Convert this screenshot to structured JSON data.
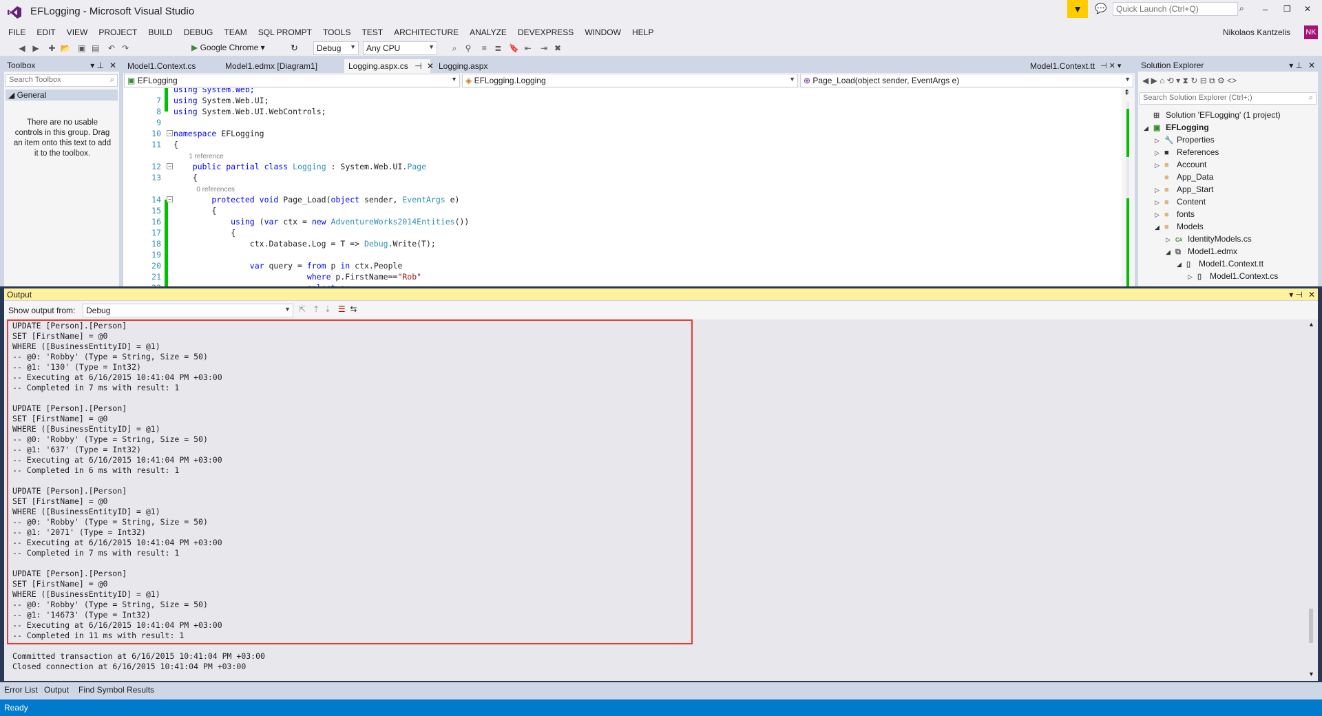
{
  "window": {
    "title": "EFLogging - Microsoft Visual Studio",
    "quick_launch_placeholder": "Quick Launch (Ctrl+Q)",
    "user": "Nikolaos Kantzelis",
    "user_initials": "NK",
    "min": "–",
    "max": "❐",
    "close": "✕"
  },
  "menu": [
    "FILE",
    "EDIT",
    "VIEW",
    "PROJECT",
    "BUILD",
    "DEBUG",
    "TEAM",
    "SQL PROMPT",
    "TOOLS",
    "TEST",
    "ARCHITECTURE",
    "ANALYZE",
    "DEVEXPRESS",
    "WINDOW",
    "HELP"
  ],
  "toolbar": {
    "run_target": "Google Chrome",
    "config": "Debug",
    "platform": "Any CPU"
  },
  "toolbox": {
    "title": "Toolbox",
    "search_placeholder": "Search Toolbox",
    "group": "General",
    "empty_text": "There are no usable controls in this group. Drag an item onto this text to add it to the toolbox."
  },
  "doc_tabs": [
    {
      "label": "Model1.Context.cs"
    },
    {
      "label": "Model1.edmx [Diagram1]"
    },
    {
      "label": "Logging.aspx.cs"
    },
    {
      "label": "Logging.aspx"
    }
  ],
  "doc_tab_right": "Model1.Context.tt",
  "nav": {
    "project": "EFLogging",
    "type": "EFLogging.Logging",
    "member": "Page_Load(object sender, EventArgs e)"
  },
  "code": [
    {
      "n": "",
      "parts": [
        {
          "t": "using System.Web;",
          "c": "kw0"
        }
      ]
    },
    {
      "n": "7",
      "parts": [
        {
          "t": "using",
          "c": "kw"
        },
        {
          "t": " System.Web.UI;"
        }
      ]
    },
    {
      "n": "8",
      "parts": [
        {
          "t": "using",
          "c": "kw"
        },
        {
          "t": " System.Web.UI.WebControls;"
        }
      ]
    },
    {
      "n": "9",
      "parts": []
    },
    {
      "n": "10",
      "parts": [
        {
          "t": "namespace",
          "c": "kw"
        },
        {
          "t": " EFLogging"
        }
      ]
    },
    {
      "n": "11",
      "parts": [
        {
          "t": "{"
        }
      ]
    },
    {
      "n": "",
      "parts": [
        {
          "t": "        1 reference",
          "c": "cl"
        }
      ]
    },
    {
      "n": "12",
      "parts": [
        {
          "t": "    "
        },
        {
          "t": "public",
          "c": "kw"
        },
        {
          "t": " "
        },
        {
          "t": "partial",
          "c": "kw"
        },
        {
          "t": " "
        },
        {
          "t": "class",
          "c": "kw"
        },
        {
          "t": " "
        },
        {
          "t": "Logging",
          "c": "ty"
        },
        {
          "t": " : System.Web.UI."
        },
        {
          "t": "Page",
          "c": "ty"
        }
      ]
    },
    {
      "n": "13",
      "parts": [
        {
          "t": "    {"
        }
      ]
    },
    {
      "n": "",
      "parts": [
        {
          "t": "            0 references",
          "c": "cl"
        }
      ]
    },
    {
      "n": "14",
      "parts": [
        {
          "t": "        "
        },
        {
          "t": "protected",
          "c": "kw"
        },
        {
          "t": " "
        },
        {
          "t": "void",
          "c": "kw"
        },
        {
          "t": " Page_Load("
        },
        {
          "t": "object",
          "c": "kw"
        },
        {
          "t": " sender, "
        },
        {
          "t": "EventArgs",
          "c": "ty"
        },
        {
          "t": " e)"
        }
      ]
    },
    {
      "n": "15",
      "parts": [
        {
          "t": "        {"
        }
      ]
    },
    {
      "n": "16",
      "parts": [
        {
          "t": "            "
        },
        {
          "t": "using",
          "c": "kw"
        },
        {
          "t": " ("
        },
        {
          "t": "var",
          "c": "kw"
        },
        {
          "t": " ctx = "
        },
        {
          "t": "new",
          "c": "kw"
        },
        {
          "t": " "
        },
        {
          "t": "AdventureWorks2014Entities",
          "c": "ty"
        },
        {
          "t": "())"
        }
      ]
    },
    {
      "n": "17",
      "parts": [
        {
          "t": "            {"
        }
      ]
    },
    {
      "n": "18",
      "parts": [
        {
          "t": "                ctx.Database.Log = T => "
        },
        {
          "t": "Debug",
          "c": "ty"
        },
        {
          "t": ".Write(T);"
        }
      ]
    },
    {
      "n": "19",
      "parts": []
    },
    {
      "n": "20",
      "parts": [
        {
          "t": "                "
        },
        {
          "t": "var",
          "c": "kw"
        },
        {
          "t": " query = "
        },
        {
          "t": "from",
          "c": "kw"
        },
        {
          "t": " p "
        },
        {
          "t": "in",
          "c": "kw"
        },
        {
          "t": " ctx.People"
        }
      ]
    },
    {
      "n": "21",
      "parts": [
        {
          "t": "                            "
        },
        {
          "t": "where",
          "c": "kw"
        },
        {
          "t": " p.FirstName=="
        },
        {
          "t": "\"Rob\"",
          "c": "st"
        }
      ]
    },
    {
      "n": "22",
      "parts": [
        {
          "t": "                            "
        },
        {
          "t": "select",
          "c": "kw"
        },
        {
          "t": " p;"
        }
      ]
    }
  ],
  "solution": {
    "title": "Solution Explorer",
    "search_placeholder": "Search Solution Explorer (Ctrl+;)",
    "items": [
      {
        "label": "Solution 'EFLogging' (1 project)",
        "level": 0,
        "exp": "",
        "icon": "solution-icon",
        "bold": false
      },
      {
        "label": "EFLogging",
        "level": 0,
        "exp": "◢",
        "icon": "project-icon",
        "bold": true
      },
      {
        "label": "Properties",
        "level": 1,
        "exp": "▷",
        "icon": "wrench-icon",
        "bold": false
      },
      {
        "label": "References",
        "level": 1,
        "exp": "▷",
        "icon": "references-icon",
        "bold": false
      },
      {
        "label": "Account",
        "level": 1,
        "exp": "▷",
        "icon": "folder-icon",
        "bold": false
      },
      {
        "label": "App_Data",
        "level": 1,
        "exp": "",
        "icon": "folder-icon",
        "bold": false
      },
      {
        "label": "App_Start",
        "level": 1,
        "exp": "▷",
        "icon": "folder-icon",
        "bold": false
      },
      {
        "label": "Content",
        "level": 1,
        "exp": "▷",
        "icon": "folder-icon",
        "bold": false
      },
      {
        "label": "fonts",
        "level": 1,
        "exp": "▷",
        "icon": "folder-icon",
        "bold": false
      },
      {
        "label": "Models",
        "level": 1,
        "exp": "◢",
        "icon": "folder-icon",
        "bold": false
      },
      {
        "label": "IdentityModels.cs",
        "level": 2,
        "exp": "▷",
        "icon": "csharp-icon",
        "bold": false
      },
      {
        "label": "Model1.edmx",
        "level": 2,
        "exp": "◢",
        "icon": "edmx-icon",
        "bold": false
      },
      {
        "label": "Model1.Context.tt",
        "level": 3,
        "exp": "◢",
        "icon": "tt-file-icon",
        "bold": false
      },
      {
        "label": "Model1.Context.cs",
        "level": 4,
        "exp": "▷",
        "icon": "tt-file-icon",
        "bold": false
      }
    ]
  },
  "output": {
    "title": "Output",
    "show_from_label": "Show output from:",
    "source": "Debug",
    "lines": [
      "UPDATE [Person].[Person]",
      "SET [FirstName] = @0",
      "WHERE ([BusinessEntityID] = @1)",
      "-- @0: 'Robby' (Type = String, Size = 50)",
      "-- @1: '130' (Type = Int32)",
      "-- Executing at 6/16/2015 10:41:04 PM +03:00",
      "-- Completed in 7 ms with result: 1",
      "",
      "UPDATE [Person].[Person]",
      "SET [FirstName] = @0",
      "WHERE ([BusinessEntityID] = @1)",
      "-- @0: 'Robby' (Type = String, Size = 50)",
      "-- @1: '637' (Type = Int32)",
      "-- Executing at 6/16/2015 10:41:04 PM +03:00",
      "-- Completed in 6 ms with result: 1",
      "",
      "UPDATE [Person].[Person]",
      "SET [FirstName] = @0",
      "WHERE ([BusinessEntityID] = @1)",
      "-- @0: 'Robby' (Type = String, Size = 50)",
      "-- @1: '2071' (Type = Int32)",
      "-- Executing at 6/16/2015 10:41:04 PM +03:00",
      "-- Completed in 7 ms with result: 1",
      "",
      "UPDATE [Person].[Person]",
      "SET [FirstName] = @0",
      "WHERE ([BusinessEntityID] = @1)",
      "-- @0: 'Robby' (Type = String, Size = 50)",
      "-- @1: '14673' (Type = Int32)",
      "-- Executing at 6/16/2015 10:41:04 PM +03:00",
      "-- Completed in 11 ms with result: 1",
      "",
      "Committed transaction at 6/16/2015 10:41:04 PM +03:00",
      "Closed connection at 6/16/2015 10:41:04 PM +03:00"
    ]
  },
  "bottom_tabs": [
    "Error List",
    "Output",
    "Find Symbol Results"
  ],
  "status": "Ready",
  "colors": {
    "accent": "#007acc",
    "highlight": "#e53935",
    "logo": "#68217a",
    "notify": "#ffcc00"
  }
}
